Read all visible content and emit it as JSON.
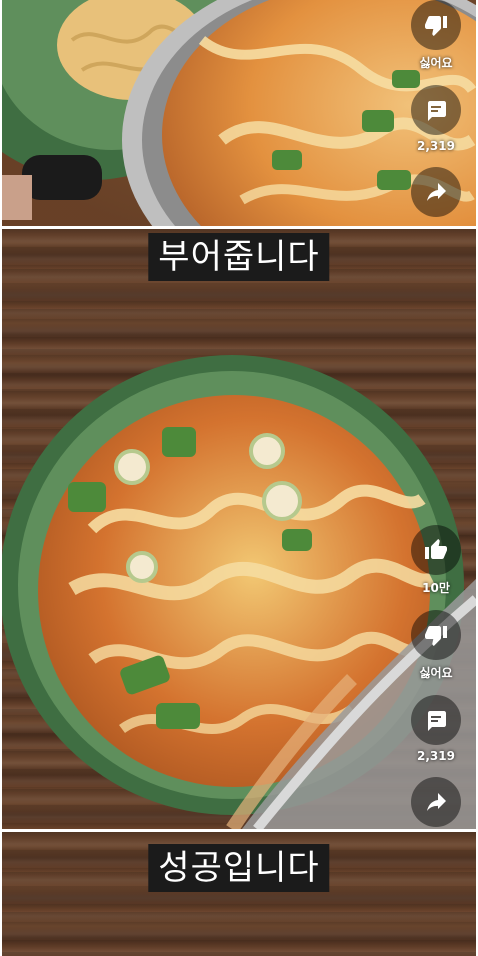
{
  "frames": [
    {
      "caption": "",
      "actions": {
        "dislike_label": "싫어요",
        "comment_count": "2,319"
      }
    },
    {
      "caption": "부어줍니다"
    },
    {
      "caption": "",
      "actions": {
        "like_count": "10만",
        "dislike_label": "싫어요",
        "comment_count": "2,319"
      }
    },
    {
      "caption": "성공입니다"
    }
  ],
  "icons": [
    "thumbs-down-icon",
    "comment-icon",
    "share-icon",
    "thumbs-up-icon"
  ],
  "colors": {
    "bowl_green": "#5f8f5c",
    "soup_orange": "#d4732f",
    "egg_yellow": "#f2c873",
    "wood": "#5a3a26",
    "caption_bg": "#1b1b1b"
  }
}
